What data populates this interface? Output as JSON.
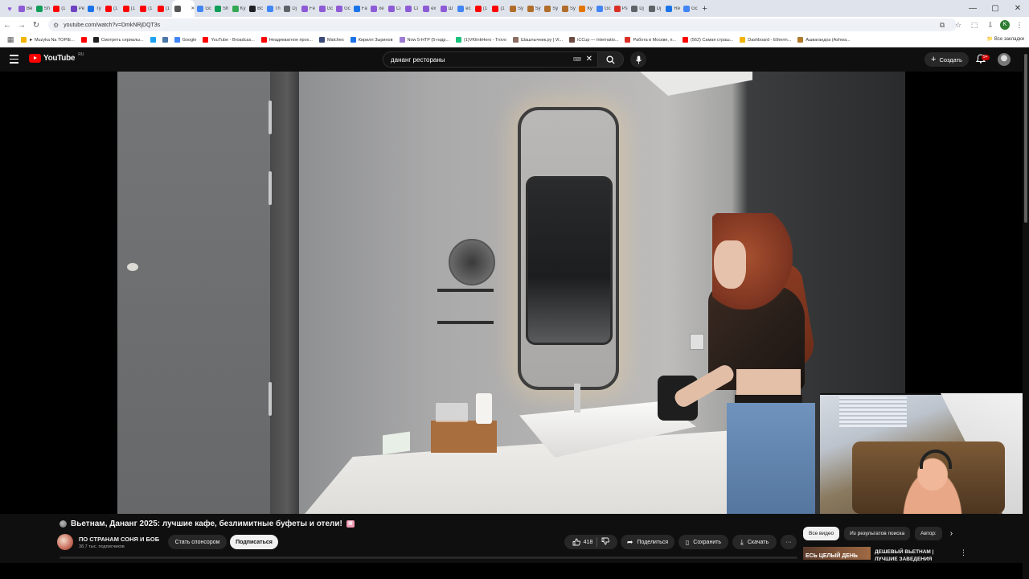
{
  "browser": {
    "tabs": [
      {
        "label": "Be",
        "color": "#8e5bd6"
      },
      {
        "label": "Sh",
        "color": "#0f9d58"
      },
      {
        "label": "(1",
        "color": "#ff0000"
      },
      {
        "label": "Pe",
        "color": "#6f42c1"
      },
      {
        "label": "Ty",
        "color": "#1a73e8"
      },
      {
        "label": "(1",
        "color": "#ff0000"
      },
      {
        "label": "(1",
        "color": "#ff0000"
      },
      {
        "label": "(1",
        "color": "#ff0000"
      },
      {
        "label": "(1",
        "color": "#ff0000"
      },
      {
        "label": "",
        "color": "#555555",
        "active": true
      },
      {
        "label": "Gc",
        "color": "#4285f4"
      },
      {
        "label": "Sh",
        "color": "#0f9d58"
      },
      {
        "label": "Ky",
        "color": "#34a853"
      },
      {
        "label": "Bc",
        "color": "#202124"
      },
      {
        "label": "Th",
        "color": "#4285f4"
      },
      {
        "label": "Dj",
        "color": "#5f6368"
      },
      {
        "label": "Fe",
        "color": "#8e5bd6"
      },
      {
        "label": "Gc",
        "color": "#8e5bd6"
      },
      {
        "label": "Gc",
        "color": "#8e5bd6"
      },
      {
        "label": "Fa",
        "color": "#1a73e8"
      },
      {
        "label": "xe",
        "color": "#8e5bd6"
      },
      {
        "label": "Ci",
        "color": "#8e5bd6"
      },
      {
        "label": "Ci",
        "color": "#8e5bd6"
      },
      {
        "label": "ex",
        "color": "#8e5bd6"
      },
      {
        "label": "Ш",
        "color": "#8e5bd6"
      },
      {
        "label": "ec",
        "color": "#4285f4"
      },
      {
        "label": "(1",
        "color": "#ff0000"
      },
      {
        "label": "(1",
        "color": "#ff0000"
      },
      {
        "label": "Sy",
        "color": "#b06d2b"
      },
      {
        "label": "Sy",
        "color": "#b06d2b"
      },
      {
        "label": "Sy",
        "color": "#b06d2b"
      },
      {
        "label": "Sy",
        "color": "#b06d2b"
      },
      {
        "label": "Ку",
        "color": "#e37400"
      },
      {
        "label": "Gc",
        "color": "#4285f4"
      },
      {
        "label": "Ps",
        "color": "#d93025"
      },
      {
        "label": "Dj",
        "color": "#5f6368"
      },
      {
        "label": "Dj",
        "color": "#5f6368"
      },
      {
        "label": "Re",
        "color": "#1a73e8"
      },
      {
        "label": "Gc",
        "color": "#4285f4"
      }
    ],
    "url": "youtube.com/watch?v=DmkNRjDQT3s",
    "profile_letter": "K",
    "bookmarks": [
      {
        "label": "► Muzyka Na TOPIE...",
        "color": "#f4b400"
      },
      {
        "label": "",
        "color": "#ff0000"
      },
      {
        "label": "Смотреть сериалы...",
        "color": "#202124"
      },
      {
        "label": "",
        "color": "#1da1f2"
      },
      {
        "label": "",
        "color": "#4a76a8"
      },
      {
        "label": "Google",
        "color": "#4285f4"
      },
      {
        "label": "YouTube - Broadcas...",
        "color": "#ff0000"
      },
      {
        "label": "Неадекватное прох...",
        "color": "#ff0000"
      },
      {
        "label": "Matches",
        "color": "#3c4a7a"
      },
      {
        "label": "Кирилл Зыринов",
        "color": "#1a73e8"
      },
      {
        "label": "Now 5-HTP (5-гидр...",
        "color": "#9c7bd6"
      },
      {
        "label": "(1)VKlinkHero - Trovo",
        "color": "#19c37d"
      },
      {
        "label": "Шашлычник.ру | Vi...",
        "color": "#8d6e63"
      },
      {
        "label": "iCCup — Internatio...",
        "color": "#6d4c41"
      },
      {
        "label": "Работа в Москве, п...",
        "color": "#d93025"
      },
      {
        "label": "(562) Самая страш...",
        "color": "#ff0000"
      },
      {
        "label": "Dashboard - Etherm...",
        "color": "#f4b400"
      },
      {
        "label": "Ашвагандха (Ashwa...",
        "color": "#b07a2a"
      }
    ],
    "all_bookmarks": "Все закладки"
  },
  "youtube": {
    "logo": "YouTube",
    "region": "RU",
    "search_value": "дананг рестораны",
    "create_label": "Создать",
    "notif_count": "9+",
    "video_title": "Вьетнам, Дананг 2025: лучшие кафе, безлимитные буфеты и отели!",
    "channel_name": "ПО СТРАНАМ СОНЯ И БОБ",
    "subscribers": "38,7 тыс. подписчиков",
    "sponsor_label": "Стать спонсором",
    "subscribe_label": "Подписаться",
    "like_count": "418",
    "share_label": "Поделиться",
    "save_label": "Сохранить",
    "download_label": "Скачать",
    "chips": [
      "Все видео",
      "Из результатов поиска",
      "Автор: "
    ],
    "rec_thumb_text": "ЕСЬ ЦЕЛЫЙ ДЕНЬ",
    "rec_title": "ДЕШЕВЫЙ ВЬЕТНАМ | ЛУЧШИЕ ЗАВЕДЕНИЯ"
  },
  "colors": {
    "accent": "#ff0000",
    "background": "#0f0f0f",
    "chip_active": "#f1f1f1"
  }
}
